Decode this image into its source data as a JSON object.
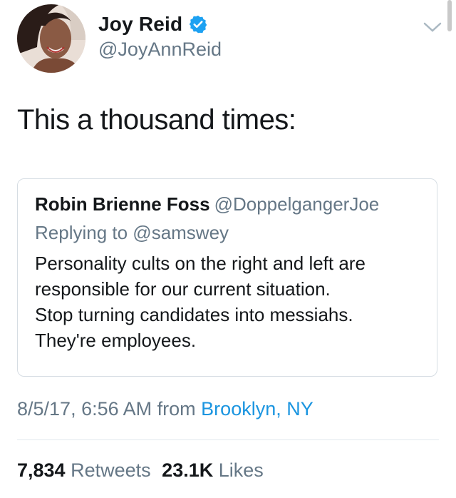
{
  "author": {
    "name": "Joy Reid",
    "handle": "@JoyAnnReid"
  },
  "tweet": {
    "text": "This a thousand times:"
  },
  "quoted": {
    "name": "Robin Brienne Foss",
    "handle": "@DoppelgangerJoe",
    "replying_to": "Replying to @samswey",
    "body_lines": [
      "Personality cults on the right and left are",
      "responsible for our current situation.",
      "Stop turning candidates into messiahs.",
      "They're employees."
    ]
  },
  "meta": {
    "timestamp": "8/5/17, 6:56 AM",
    "from_label": "from",
    "location": "Brooklyn, NY"
  },
  "stats": {
    "retweets_count": "7,834",
    "retweets_label": "Retweets",
    "likes_count": "23.1K",
    "likes_label": "Likes"
  },
  "colors": {
    "link": "#1b95e0",
    "secondary_text": "#657786",
    "verified": "#1da1f2"
  },
  "icons": {
    "verified": "verified-badge-icon",
    "more": "chevron-down-icon"
  }
}
